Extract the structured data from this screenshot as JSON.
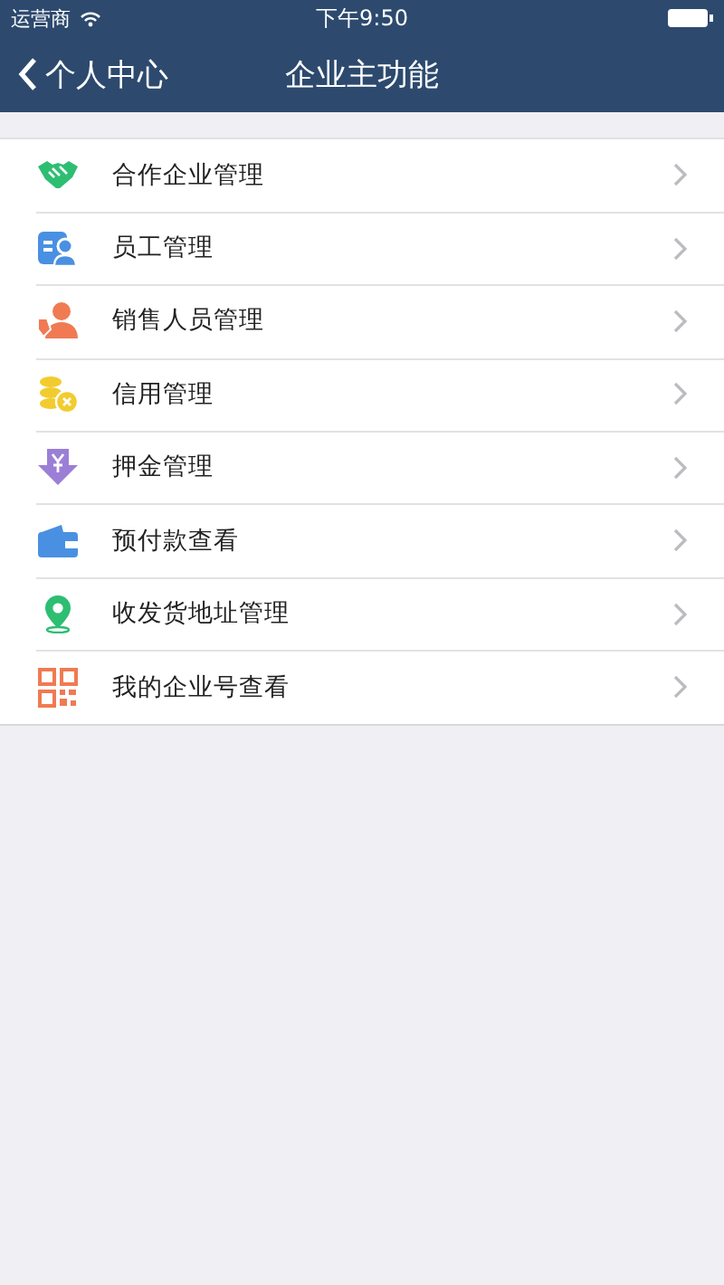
{
  "status_bar": {
    "carrier": "运营商",
    "time": "下午9:50"
  },
  "nav_bar": {
    "back_label": "个人中心",
    "title": "企业主功能"
  },
  "menu": [
    {
      "label": "合作企业管理"
    },
    {
      "label": "员工管理"
    },
    {
      "label": "销售人员管理"
    },
    {
      "label": "信用管理"
    },
    {
      "label": "押金管理"
    },
    {
      "label": "预付款查看"
    },
    {
      "label": "收发货地址管理"
    },
    {
      "label": "我的企业号查看"
    }
  ]
}
